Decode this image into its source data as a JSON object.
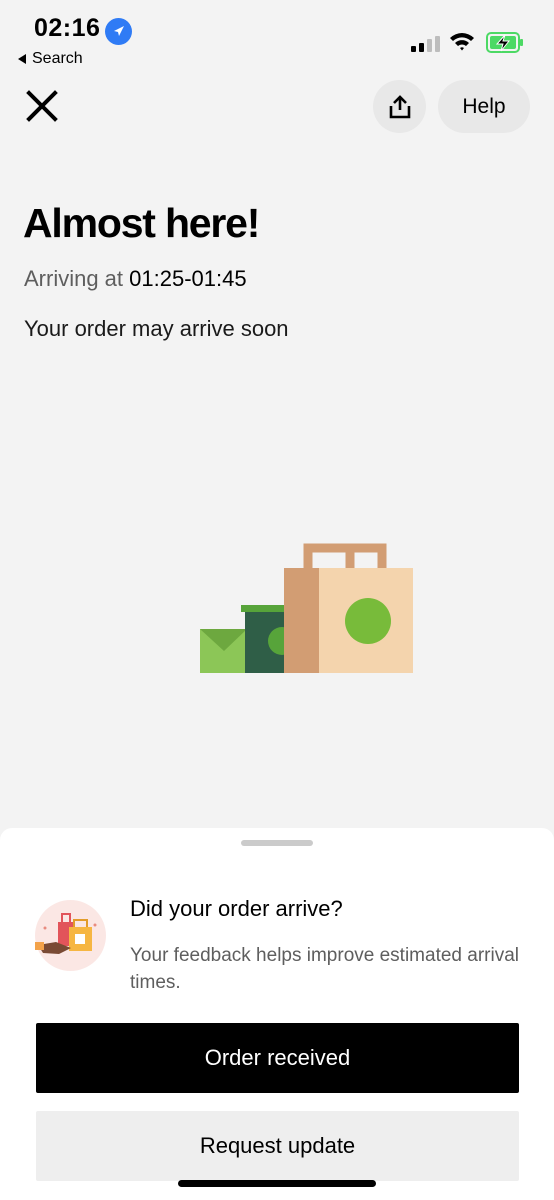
{
  "status_bar": {
    "time": "02:16",
    "back_label": "Search",
    "icons": [
      "location-arrow-icon",
      "cellular-signal-icon",
      "wifi-icon",
      "battery-charging-icon"
    ]
  },
  "header": {
    "close_icon": "close-icon",
    "share_icon": "share-icon",
    "help_label": "Help"
  },
  "main": {
    "headline": "Almost here!",
    "arriving_label": "Arriving at",
    "arriving_time": "01:25-01:45",
    "subline": "Your order may arrive soon"
  },
  "feedback": {
    "icon": "shopping-bags-icon",
    "title": "Did your order arrive?",
    "description": "Your feedback helps improve estimated arrival times.",
    "primary_button": "Order received",
    "secondary_button": "Request update"
  },
  "colors": {
    "primary_button_bg": "#000000",
    "secondary_button_bg": "#eeeeee",
    "location_badge": "#2f7bf5",
    "battery_green": "#4cd964"
  }
}
